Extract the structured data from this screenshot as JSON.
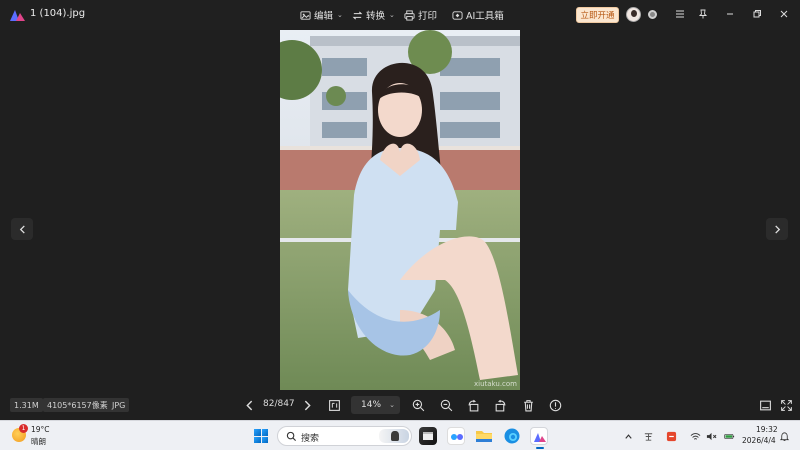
{
  "window": {
    "file_title": "1 (104).jpg",
    "tools": [
      {
        "label": "编辑",
        "icon": "edit-image-icon"
      },
      {
        "label": "转换",
        "icon": "convert-icon"
      },
      {
        "label": "打印",
        "icon": "printer-icon"
      },
      {
        "label": "AI工具箱",
        "icon": "ai-toolbox-icon"
      }
    ],
    "vip_label": "立即开通"
  },
  "viewer": {
    "watermark": "xiutaku.com"
  },
  "status": {
    "file_size": "1.31M",
    "dimensions": "4105*6157像素",
    "format": "JPG",
    "page_counter": "82/847",
    "zoom": "14%"
  },
  "taskbar": {
    "weather_temp": "19°C",
    "weather_desc": "晴朗",
    "weather_badge": "1",
    "search_placeholder": "搜索",
    "clock_time": "19:32",
    "clock_date": "2026/4/4"
  },
  "colors": {
    "background": "#1f1f1f",
    "vip_bg": "#fbe6cf",
    "vip_text": "#b85a16",
    "taskbar": "#eef0f4"
  }
}
